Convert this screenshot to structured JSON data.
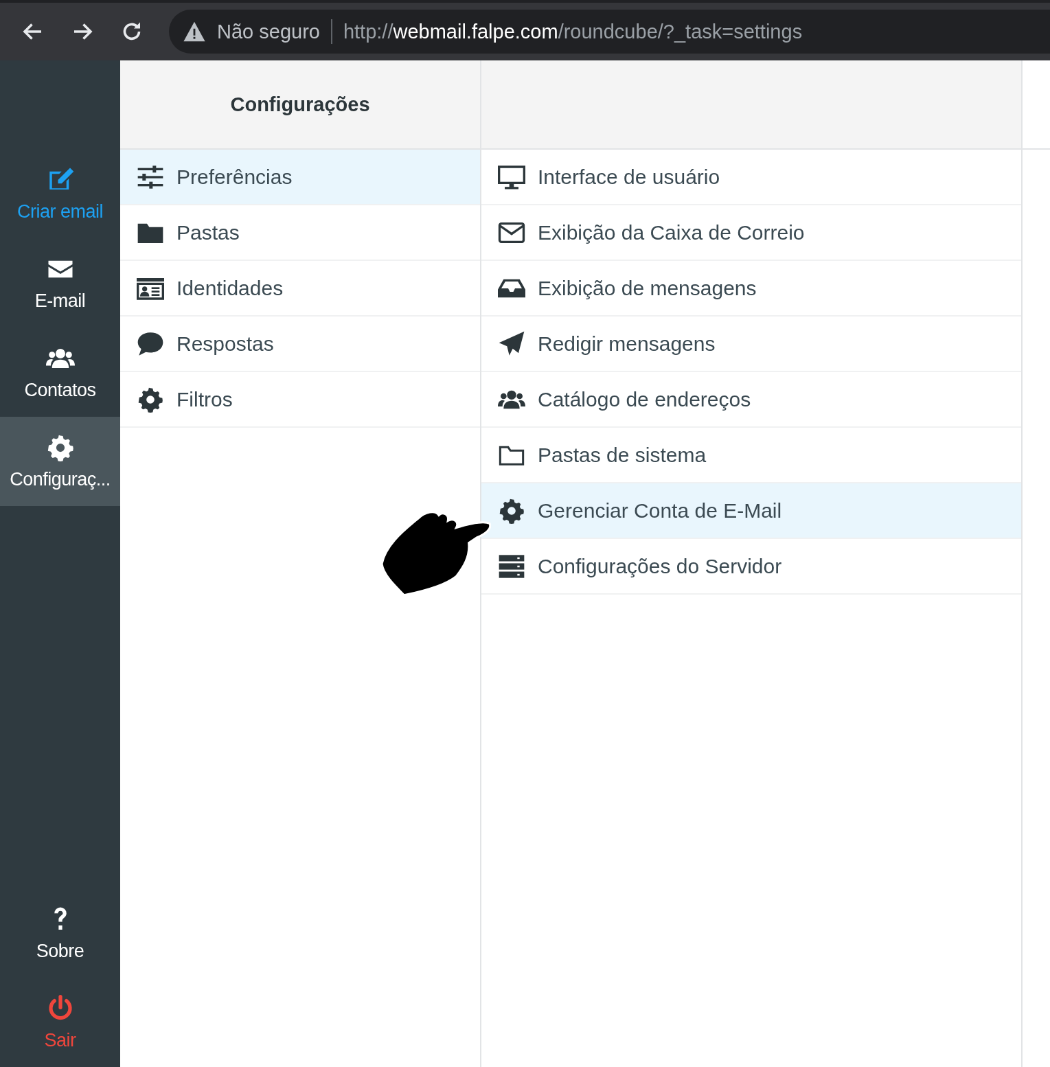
{
  "browser": {
    "security_label": "Não seguro",
    "url_scheme": "http://",
    "url_host": "webmail.falpe.com",
    "url_path": "/roundcube/?_task=settings"
  },
  "nav": {
    "items": [
      {
        "label": "Criar email",
        "kind": "compose",
        "selected": false
      },
      {
        "label": "E-mail",
        "kind": "mail",
        "selected": false
      },
      {
        "label": "Contatos",
        "kind": "contacts",
        "selected": false
      },
      {
        "label": "Configuraç...",
        "kind": "settings",
        "selected": true
      }
    ],
    "footer_items": [
      {
        "label": "Sobre",
        "kind": "about",
        "selected": false
      },
      {
        "label": "Sair",
        "kind": "logout",
        "selected": false
      }
    ]
  },
  "settings": {
    "title": "Configurações",
    "sections": [
      {
        "label": "Preferências",
        "kind": "sliders",
        "selected": true
      },
      {
        "label": "Pastas",
        "kind": "folder",
        "selected": false
      },
      {
        "label": "Identidades",
        "kind": "idcard",
        "selected": false
      },
      {
        "label": "Respostas",
        "kind": "comment",
        "selected": false
      },
      {
        "label": "Filtros",
        "kind": "gear",
        "selected": false
      }
    ]
  },
  "preferences": [
    {
      "label": "Interface de usuário",
      "kind": "monitor",
      "selected": false
    },
    {
      "label": "Exibição da Caixa de Correio",
      "kind": "envelope",
      "selected": false
    },
    {
      "label": "Exibição de mensagens",
      "kind": "inbox",
      "selected": false
    },
    {
      "label": "Redigir mensagens",
      "kind": "plane",
      "selected": false
    },
    {
      "label": "Catálogo de endereços",
      "kind": "users",
      "selected": false
    },
    {
      "label": "Pastas de sistema",
      "kind": "folder-outline",
      "selected": false
    },
    {
      "label": "Gerenciar Conta de E-Mail",
      "kind": "gear",
      "selected": true
    },
    {
      "label": "Configurações do Servidor",
      "kind": "server",
      "selected": false
    }
  ]
}
